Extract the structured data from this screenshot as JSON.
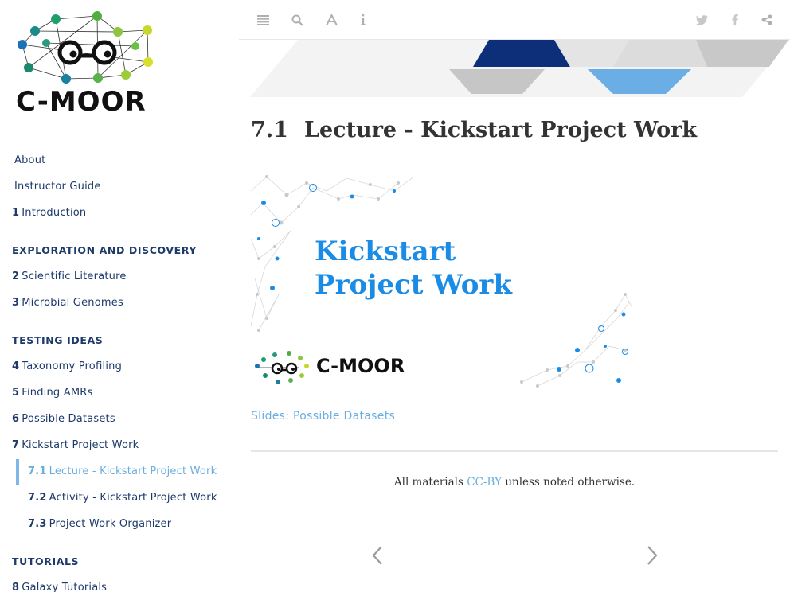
{
  "sidebar": {
    "logo_text": "C-MOOR",
    "items": [
      {
        "num": "",
        "label": "About"
      },
      {
        "num": "",
        "label": "Instructor Guide"
      },
      {
        "num": "1",
        "label": "Introduction"
      },
      {
        "heading": "EXPLORATION AND DISCOVERY"
      },
      {
        "num": "2",
        "label": "Scientific Literature"
      },
      {
        "num": "3",
        "label": "Microbial Genomes"
      },
      {
        "heading": "TESTING IDEAS"
      },
      {
        "num": "4",
        "label": "Taxonomy Profiling"
      },
      {
        "num": "5",
        "label": "Finding AMRs"
      },
      {
        "num": "6",
        "label": "Possible Datasets"
      },
      {
        "num": "7",
        "label": "Kickstart Project Work"
      },
      {
        "num": "7.1",
        "label": "Lecture - Kickstart Project Work"
      },
      {
        "num": "7.2",
        "label": "Activity - Kickstart Project Work"
      },
      {
        "num": "7.3",
        "label": "Project Work Organizer"
      },
      {
        "heading": "TUTORIALS"
      },
      {
        "num": "8",
        "label": "Galaxy Tutorials"
      }
    ]
  },
  "toolbar": {
    "left_icons": [
      "list-icon",
      "search-icon",
      "font-icon",
      "info-icon"
    ],
    "right_icons": [
      "twitter-icon",
      "facebook-icon",
      "share-icon"
    ]
  },
  "main": {
    "section_number": "7.1",
    "title": "Lecture - Kickstart Project Work",
    "slide_title": "Kickstart Project Work",
    "slide_logo_text": "C-MOOR",
    "slides_link": "Slides: Possible Datasets",
    "footer_prefix": "All materials",
    "footer_link": "CC-BY",
    "footer_suffix": "unless noted otherwise."
  },
  "nav_arrows": [
    "prev-arrow-icon",
    "next-arrow-icon"
  ],
  "colors": {
    "nav_text": "#1d3a6b",
    "accent": "#6aaee0",
    "slide_title": "#1a8ce6",
    "banner_navy": "#0d2f7a",
    "banner_light_blue": "#6aaee5"
  }
}
